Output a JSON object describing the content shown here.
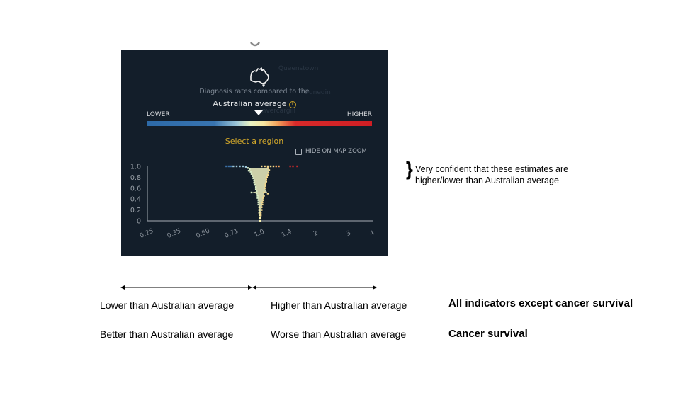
{
  "panel": {
    "subtitle": "Diagnosis rates compared to the",
    "title": "Australian average",
    "info_icon": "info-icon",
    "lower_label": "LOWER",
    "higher_label": "HIGHER",
    "select_prompt": "Select a region",
    "hide_on_map_zoom_label": "HIDE ON MAP ZOOM",
    "hide_on_map_zoom_checked": false,
    "background_map_labels": [
      "Queenstown",
      "Dunedin",
      "Invercargill"
    ],
    "colors": {
      "background": "#131e2a",
      "lower": "#2d6aa8",
      "middle": "#f6e6a0",
      "higher": "#d01e24",
      "accent": "#d4a92a"
    }
  },
  "chart_data": {
    "type": "scatter",
    "title": "",
    "xlabel": "",
    "ylabel": "",
    "x_scale": "log",
    "x_ticks": [
      "0.25",
      "0.35",
      "0.50",
      "0.71",
      "1.0",
      "1.4",
      "2",
      "3",
      "4"
    ],
    "y_ticks": [
      "1.0",
      "0.8",
      "0.6",
      "0.4",
      "0.2",
      "0"
    ],
    "xlim": [
      0.25,
      4
    ],
    "ylim": [
      0,
      1
    ],
    "grid": false,
    "description": "Funnel of region estimates: ratio to Australian average (x) vs confidence (y); points converge at 1.0 near y=0 and spread to ~0.8-1.3 at y=1.0, with sparse outliers at y=1.0 from ~0.66 to ~1.6",
    "series": [
      {
        "name": "lower-than-average",
        "color": "#cfe6c8",
        "points": [
          [
            0.66,
            1.0
          ],
          [
            0.68,
            1.0
          ],
          [
            0.7,
            1.0
          ],
          [
            0.72,
            1.0
          ],
          [
            0.75,
            1.0
          ],
          [
            0.78,
            1.0
          ],
          [
            0.81,
            1.0
          ],
          [
            0.84,
            0.99
          ],
          [
            0.86,
            0.97
          ],
          [
            0.88,
            0.95
          ],
          [
            0.87,
            0.92
          ],
          [
            0.89,
            0.9
          ],
          [
            0.9,
            0.86
          ],
          [
            0.91,
            0.82
          ],
          [
            0.92,
            0.78
          ],
          [
            0.93,
            0.74
          ],
          [
            0.93,
            0.7
          ],
          [
            0.94,
            0.66
          ],
          [
            0.95,
            0.62
          ],
          [
            0.95,
            0.58
          ],
          [
            0.96,
            0.54
          ],
          [
            0.9,
            0.52
          ],
          [
            0.96,
            0.5
          ],
          [
            0.97,
            0.46
          ],
          [
            0.97,
            0.42
          ],
          [
            0.98,
            0.38
          ],
          [
            0.98,
            0.34
          ],
          [
            0.98,
            0.3
          ],
          [
            0.99,
            0.25
          ],
          [
            0.99,
            0.2
          ],
          [
            0.99,
            0.15
          ],
          [
            1.0,
            0.1
          ],
          [
            1.0,
            0.05
          ],
          [
            1.0,
            0.0
          ]
        ]
      },
      {
        "name": "higher-than-average",
        "color": "#f4d88a",
        "points": [
          [
            1.02,
            1.0
          ],
          [
            1.06,
            1.0
          ],
          [
            1.1,
            1.0
          ],
          [
            1.14,
            1.0
          ],
          [
            1.18,
            1.0
          ],
          [
            1.22,
            1.0
          ],
          [
            1.26,
            1.0
          ],
          [
            1.45,
            1.0
          ],
          [
            1.5,
            1.0
          ],
          [
            1.58,
            1.0
          ],
          [
            1.1,
            0.97
          ],
          [
            1.12,
            0.93
          ],
          [
            1.11,
            0.88
          ],
          [
            1.1,
            0.84
          ],
          [
            1.09,
            0.8
          ],
          [
            1.08,
            0.76
          ],
          [
            1.08,
            0.72
          ],
          [
            1.07,
            0.68
          ],
          [
            1.07,
            0.64
          ],
          [
            1.06,
            0.6
          ],
          [
            1.1,
            0.5
          ],
          [
            1.05,
            0.52
          ],
          [
            1.05,
            0.46
          ],
          [
            1.04,
            0.42
          ],
          [
            1.04,
            0.38
          ],
          [
            1.03,
            0.34
          ],
          [
            1.03,
            0.3
          ],
          [
            1.02,
            0.25
          ],
          [
            1.02,
            0.2
          ],
          [
            1.01,
            0.15
          ],
          [
            1.01,
            0.1
          ],
          [
            1.0,
            0.05
          ]
        ]
      }
    ]
  },
  "annotation": {
    "brace": "}",
    "text": "Very confident that these estimates are higher/lower than Australian average"
  },
  "legend_rows": {
    "left_header": "Lower than Australian average",
    "right_header": "Higher than Australian average",
    "row1_label": "All indicators except cancer survival",
    "left_row2": "Better than Australian average",
    "right_row2": "Worse than Australian average",
    "row2_label": "Cancer survival"
  }
}
